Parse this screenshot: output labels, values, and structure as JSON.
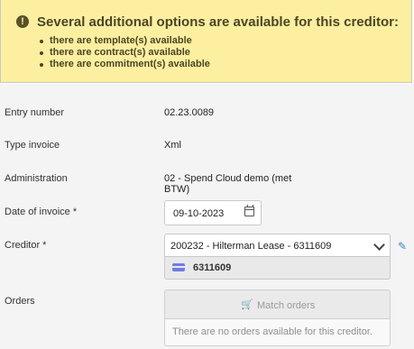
{
  "alert": {
    "icon": "exclamation-circle-icon",
    "title": "Several additional options are available for this creditor:",
    "items": [
      "there are template(s) available",
      "there are contract(s) available",
      "there are commitment(s) available"
    ]
  },
  "form": {
    "entry_number": {
      "label": "Entry number",
      "value": "02.23.0089"
    },
    "type_invoice": {
      "label": "Type invoice",
      "value": "Xml"
    },
    "administration": {
      "label": "Administration",
      "value_line1": "02 - Spend Cloud demo (met",
      "value_line2": "BTW)"
    },
    "date_of_invoice": {
      "label": "Date of invoice *",
      "value": "09-10-2023",
      "icon": "calendar-icon"
    },
    "creditor": {
      "label": "Creditor *",
      "selected": "200232 - Hilterman Lease - 6311609",
      "detail": "6311609",
      "detail_icon": "credit-card-icon",
      "edit_icon": "edit-icon"
    },
    "orders": {
      "label": "Orders",
      "button_label": "Match orders",
      "button_icon": "cart-icon",
      "note": "There are no orders available for this creditor."
    }
  },
  "colors": {
    "alert_bg": "#fcefa0",
    "form_bg": "#f4f4f4",
    "accent": "#3a86c8",
    "card_icon": "#6f7be6"
  }
}
